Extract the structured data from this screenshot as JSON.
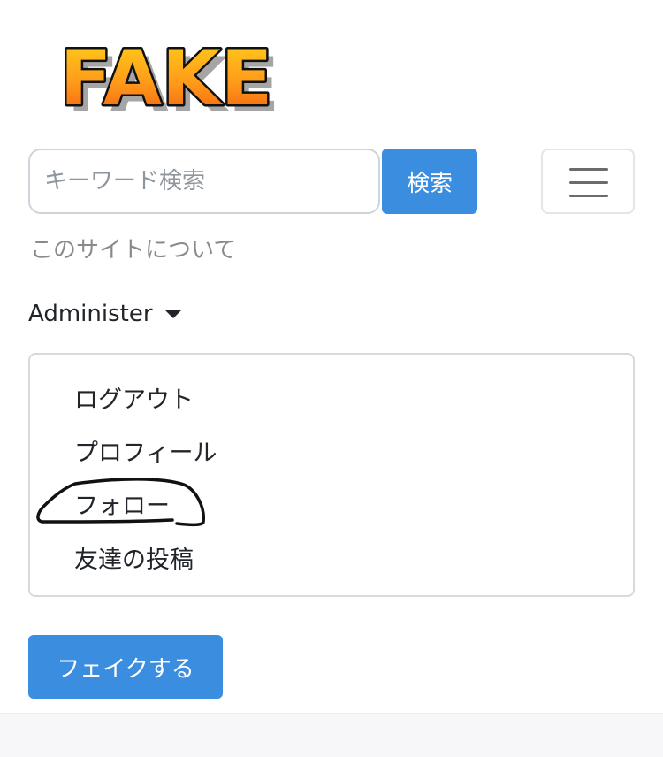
{
  "header": {
    "logo_text": "FAKE"
  },
  "search": {
    "placeholder": "キーワード検索",
    "button_label": "検索"
  },
  "nav": {
    "about_label": "このサイトについて",
    "menu_icon": "hamburger-icon"
  },
  "admin": {
    "label": "Administer",
    "items": [
      {
        "label": "ログアウト"
      },
      {
        "label": "プロフィール"
      },
      {
        "label": "フォロー"
      },
      {
        "label": "友達の投稿"
      }
    ]
  },
  "actions": {
    "fake_label": "フェイクする"
  },
  "colors": {
    "primary": "#3a8ddf",
    "logo_fill_top": "#ffd21a",
    "logo_fill_bottom": "#f0570f"
  }
}
